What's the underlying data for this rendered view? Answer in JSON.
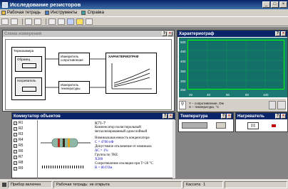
{
  "window": {
    "title": "Исследование резисторов"
  },
  "menu": [
    {
      "label": "Рабочая тетрадь"
    },
    {
      "label": "Инструменты"
    },
    {
      "label": "Справка"
    }
  ],
  "scheme": {
    "title": "Схема измерения",
    "thermochamber": "Термокамера",
    "sample": "Образец",
    "heater": "Нагреватель",
    "resistance_meter": "Измеритель сопротивления",
    "temp_meter": "Измеритель температуры",
    "characteristic": "ХАРАКТЕРИОГРАФ"
  },
  "graph": {
    "title": "Характериограф",
    "y_ticks": [
      "500",
      "450",
      "400",
      "350",
      "300",
      "250"
    ],
    "x_ticks": [
      "20",
      "40",
      "60",
      "80",
      "100"
    ],
    "legend_y": "Y – сопротивление, Ом",
    "legend_x": "X – температура, °C"
  },
  "commutator": {
    "title": "Коммутатор объектов",
    "items": [
      "R1",
      "R2",
      "R3",
      "R4",
      "R5",
      "R6",
      "R7",
      "R8",
      "R9"
    ],
    "doc": {
      "heading": "К71-7",
      "line1": "Компенсатор полистирольный",
      "line2": "металлизированный однослойный",
      "p1": "Номинальная емкость конденсатора",
      "p1v": "С = 4700 пФ",
      "p2": "Допустимое отклонение от номинала",
      "p2v": "ΔС = 1%",
      "p3": "Группа по ТКЕ",
      "p3v": "Х200",
      "p4": "Сопротивление изоляции при Т=20 °С",
      "p4v": "R = 80 ГОм"
    }
  },
  "temperature": {
    "title": "Температура"
  },
  "heater": {
    "title": "Нагреватель"
  },
  "status": {
    "device": "Прибор включен",
    "notebook_label": "Рабочая тетрадь:",
    "notebook_value": "не открыта",
    "cassette": "Кассета",
    "cassette_num": "1"
  }
}
